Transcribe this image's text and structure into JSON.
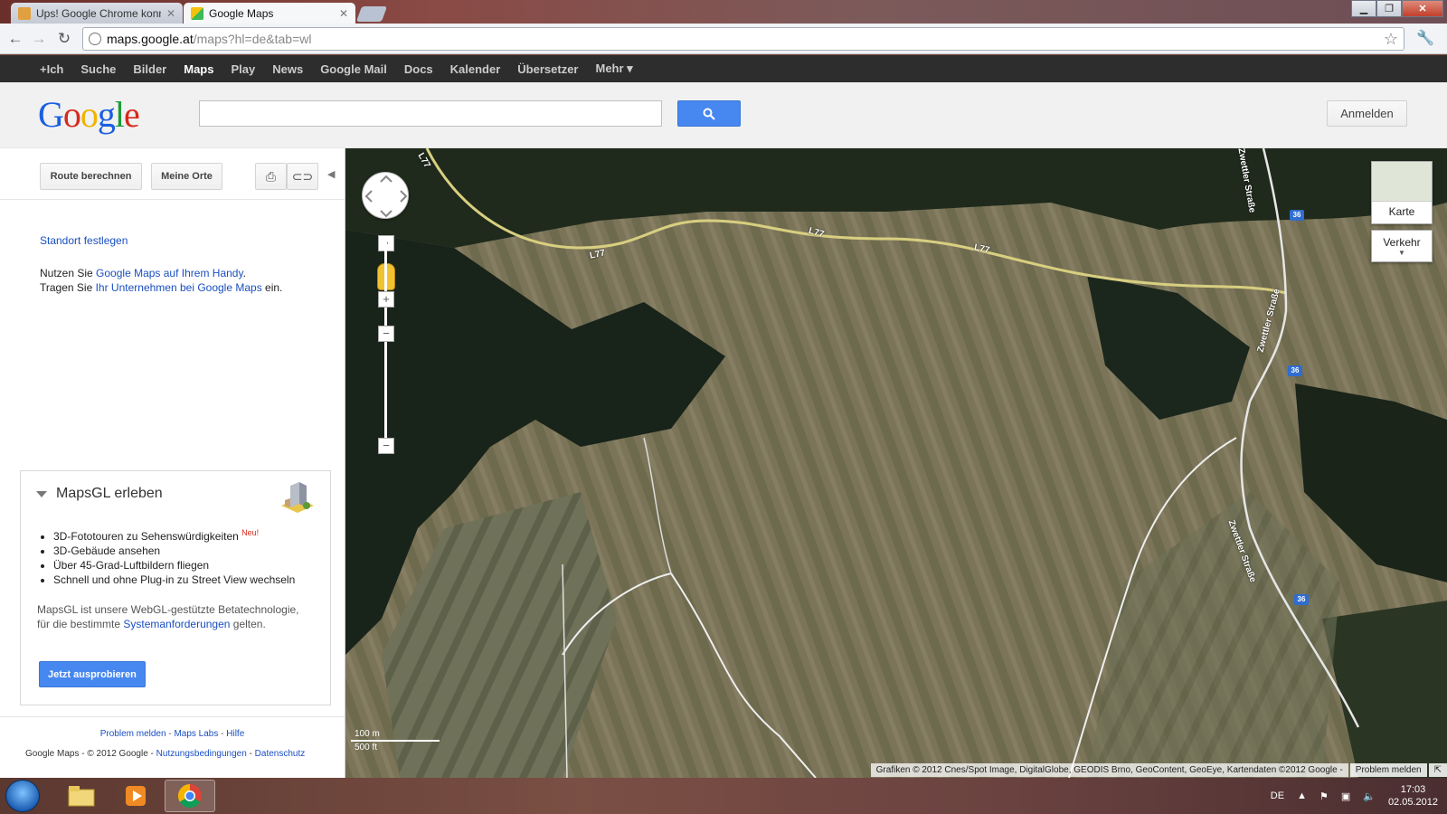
{
  "browser": {
    "tabs": [
      {
        "title": "Ups! Google Chrome konnt",
        "active": false
      },
      {
        "title": "Google Maps",
        "active": true
      }
    ],
    "url_host": "maps.google.at",
    "url_rest": "/maps?hl=de&tab=wl"
  },
  "gbar": {
    "items": [
      "+Ich",
      "Suche",
      "Bilder",
      "Maps",
      "Play",
      "News",
      "Google Mail",
      "Docs",
      "Kalender",
      "Übersetzer",
      "Mehr ▾"
    ],
    "selected": "Maps"
  },
  "header": {
    "logo": [
      "G",
      "o",
      "o",
      "g",
      "l",
      "e"
    ],
    "search_value": "",
    "signin": "Anmelden"
  },
  "sidebar": {
    "route_button": "Route berechnen",
    "places_button": "Meine Orte",
    "locate_link": "Standort festlegen",
    "promo_line1_pre": "Nutzen Sie ",
    "promo_line1_link": "Google Maps auf Ihrem Handy",
    "promo_line1_post": ".",
    "promo_line2_pre": "Tragen Sie ",
    "promo_line2_link": "Ihr Unternehmen bei Google Maps",
    "promo_line2_post": " ein.",
    "mapsgl": {
      "title": "MapsGL erleben",
      "features": [
        "3D-Fototouren zu Sehenswürdigkeiten",
        "3D-Gebäude ansehen",
        "Über 45-Grad-Luftbildern fliegen",
        "Schnell und ohne Plug-in zu Street View wechseln"
      ],
      "new_badge": "Neu!",
      "desc_pre": "MapsGL ist unsere WebGL-gestützte Betatechnologie, für die bestimmte ",
      "desc_link": "Systemanforderungen",
      "desc_post": " gelten.",
      "try_button": "Jetzt ausprobieren"
    },
    "footer_links": [
      "Problem melden",
      "Maps Labs",
      "Hilfe"
    ],
    "copyright": "Google Maps - © 2012 Google - ",
    "terms": "Nutzungsbedingungen",
    "privacy": "Datenschutz"
  },
  "map": {
    "maptype_label": "Karte",
    "traffic_label": "Verkehr",
    "scale_metric": "100 m",
    "scale_imperial": "500 ft",
    "attribution": "Grafiken © 2012 Cnes/Spot Image, DigitalGlobe, GEODIS Brno, GeoContent, GeoEye, Kartendaten ©2012 Google -",
    "report_problem": "Problem melden",
    "road_labels": [
      "L77",
      "L77",
      "L77",
      "L77",
      "Zwettler Straße",
      "Zwettler Straße",
      "Zwettler Straße"
    ],
    "route_shields": [
      "36",
      "36",
      "36"
    ]
  },
  "taskbar": {
    "language": "DE",
    "time": "17:03",
    "date": "02.05.2012"
  },
  "colors": {
    "gbar_bg": "#2d2d2d",
    "search_blue": "#4687f0",
    "link_blue": "#1a4fc0"
  }
}
